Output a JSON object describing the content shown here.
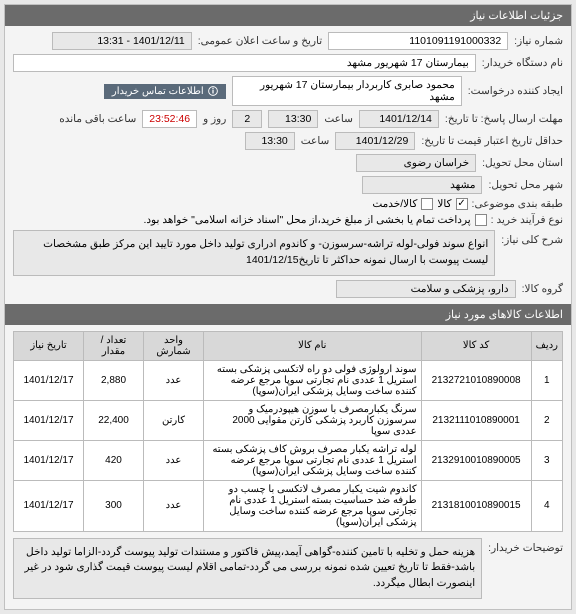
{
  "panel": {
    "title": "جزئیات اطلاعات نیاز"
  },
  "fields": {
    "need_number_label": "شماره نیاز:",
    "need_number": "1101091191000332",
    "announce_label": "تاریخ و ساعت اعلان عمومی:",
    "announce_value": "1401/12/11 - 13:31",
    "buyer_org_label": "نام دستگاه خریدار:",
    "buyer_org": "بیمارستان 17 شهریور مشهد",
    "creator_label": "ایجاد کننده درخواست:",
    "creator": "محمود صابری کاربردار بیمارستان 17 شهریور مشهد",
    "buyer_info_btn": "اطلاعات تماس خریدار",
    "deadline_label": "مهلت ارسال پاسخ: تا تاریخ:",
    "deadline_date": "1401/12/14",
    "time_label": "ساعت",
    "deadline_time": "13:30",
    "days_label": "روز و",
    "days_value": "2",
    "remain_time": "23:52:46",
    "remain_label": "ساعت باقی مانده",
    "min_valid_label": "حداقل تاریخ اعتبار قیمت تا تاریخ:",
    "min_valid_date": "1401/12/29",
    "min_valid_time": "13:30",
    "province_label": "استان محل تحویل:",
    "province": "خراسان رضوی",
    "city_label": "شهر محل تحویل:",
    "city": "مشهد",
    "budget_label": "طبقه بندی موضوعی:",
    "cb_goods": "کالا",
    "cb_service": "کالا/خدمت",
    "process_label": "نوع فرآیند خرید :",
    "process_note": "پرداخت تمام یا بخشی از مبلغ خرید،از محل \"اسناد خزانه اسلامی\" خواهد بود.",
    "desc_label": "شرح کلی نیاز:",
    "desc_text": "انواع سوند فولی-لوله تراشه-سرسوزن- و کاندوم ادراری تولید داخل مورد تایید این مرکز طبق مشخصات لیست پیوست با ارسال نمونه حداکثر تا تاریخ1401/12/15",
    "group_label": "گروه کالا:",
    "group_value": "دارو، پزشکی و سلامت",
    "items_header": "اطلاعات کالاهای مورد نیاز",
    "notes_label": "توضیحات خریدار:",
    "notes_text": "هزینه حمل و تخلیه با تامین کننده-گواهی آیمد،پیش فاکتور و مستندات تولید پیوست گردد-الزاما تولید داخل باشد-فقط تا تاریخ تعیین شده نمونه بررسی می گردد-تمامی اقلام لیست پیوست قیمت گذاری شود در غیر اینصورت ابطال میگردد."
  },
  "table": {
    "headers": {
      "row": "ردیف",
      "code": "کد کالا",
      "name": "نام کالا",
      "unit": "واحد شمارش",
      "qty": "تعداد / مقدار",
      "date": "تاریخ نیاز"
    },
    "rows": [
      {
        "n": "1",
        "code": "2132721010890008",
        "name": "سوند ارولوژی فولی دو راه لاتکسی پزشکی بسته استریل 1 عددی نام تجارتی سوپا مرجع عرضه کننده ساخت وسایل پزشکی ایران(سوپا)",
        "unit": "عدد",
        "qty": "2,880",
        "date": "1401/12/17"
      },
      {
        "n": "2",
        "code": "2132111010890001",
        "name": "سرنگ یکبارمصرف با سوزن هیپودرمیک و سرسوزن کاربرد پزشکی کارتن مقوایی 2000 عددی سوپا",
        "unit": "کارتن",
        "qty": "22,400",
        "date": "1401/12/17"
      },
      {
        "n": "3",
        "code": "2132910010890005",
        "name": "لوله تراشه یکبار مصرف بروش کاف پزشکی بسته استریل 1 عددی نام تجارتی سوپا مرجع عرضه کننده ساخت وسایل پزشکی ایران(سوپا)",
        "unit": "عدد",
        "qty": "420",
        "date": "1401/12/17"
      },
      {
        "n": "4",
        "code": "2131810010890015",
        "name": "کاندوم شیت یکبار مصرف لاتکسی با چسب دو طرفه ضد حساسیت بسته استریل 1 عددی نام تجارتی سوپا مرجع عرضه کننده ساخت وسایل پزشکی ایران(سوپا)",
        "unit": "عدد",
        "qty": "300",
        "date": "1401/12/17"
      }
    ]
  }
}
